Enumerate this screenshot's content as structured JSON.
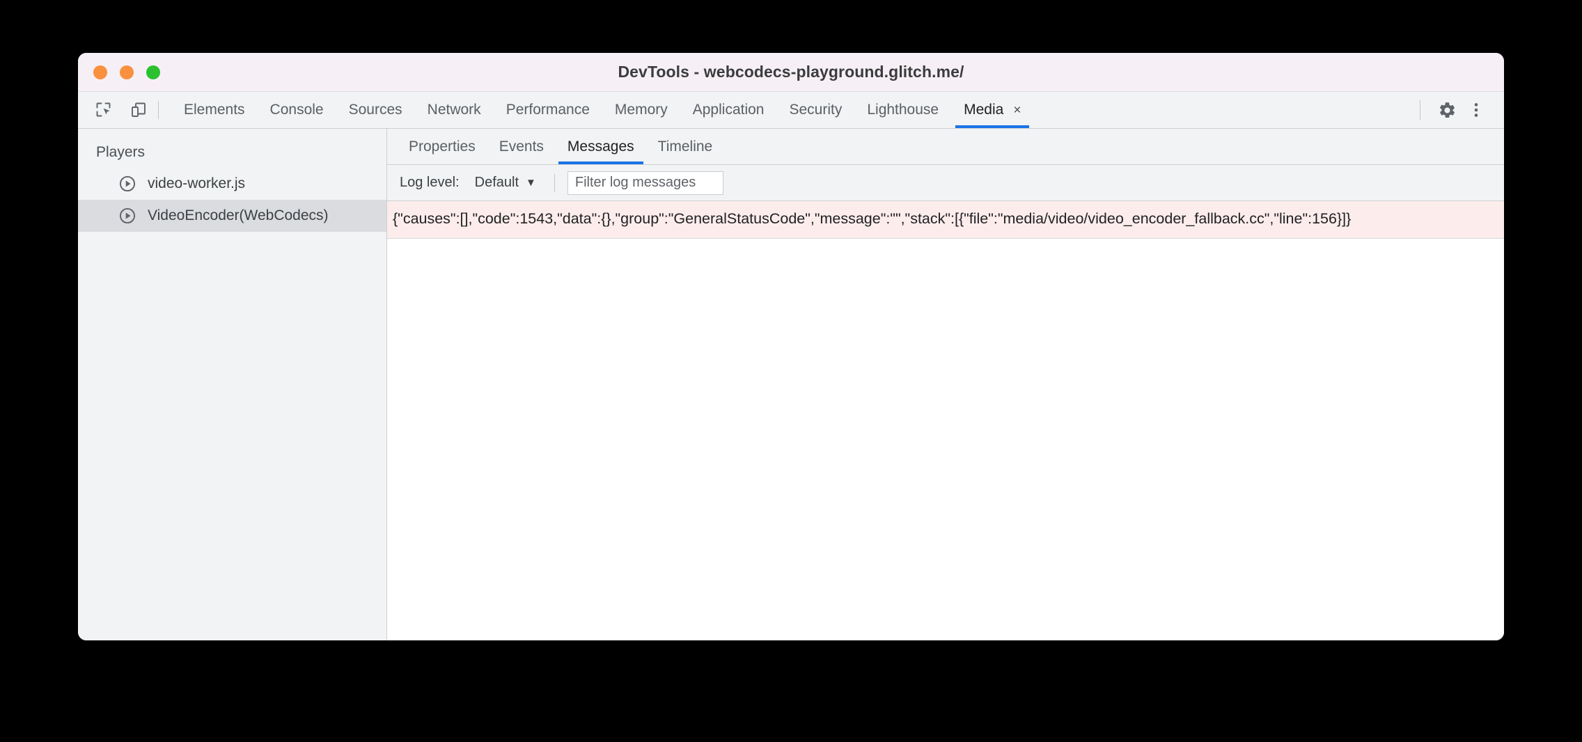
{
  "window": {
    "title": "DevTools - webcodecs-playground.glitch.me/",
    "traffic_lights": {
      "close_color": "#f9903e",
      "minimize_color": "#f9903e",
      "maximize_color": "#2bc030"
    }
  },
  "toolbar": {
    "inspect_icon": "inspect-element-icon",
    "device_icon": "device-toolbar-icon",
    "settings_icon": "gear-icon",
    "more_icon": "more-vertical-icon"
  },
  "tabs": [
    {
      "label": "Elements",
      "active": false,
      "closable": false
    },
    {
      "label": "Console",
      "active": false,
      "closable": false
    },
    {
      "label": "Sources",
      "active": false,
      "closable": false
    },
    {
      "label": "Network",
      "active": false,
      "closable": false
    },
    {
      "label": "Performance",
      "active": false,
      "closable": false
    },
    {
      "label": "Memory",
      "active": false,
      "closable": false
    },
    {
      "label": "Application",
      "active": false,
      "closable": false
    },
    {
      "label": "Security",
      "active": false,
      "closable": false
    },
    {
      "label": "Lighthouse",
      "active": false,
      "closable": false
    },
    {
      "label": "Media",
      "active": true,
      "closable": true,
      "close_label": "×"
    }
  ],
  "sidebar": {
    "title": "Players",
    "items": [
      {
        "label": "video-worker.js",
        "icon": "play-circle-icon",
        "selected": false
      },
      {
        "label": "VideoEncoder(WebCodecs)",
        "icon": "play-circle-icon",
        "selected": true
      }
    ]
  },
  "subtabs": [
    {
      "label": "Properties",
      "active": false
    },
    {
      "label": "Events",
      "active": false
    },
    {
      "label": "Messages",
      "active": true
    },
    {
      "label": "Timeline",
      "active": false
    }
  ],
  "logbar": {
    "log_level_label": "Log level:",
    "log_level_value": "Default",
    "caret": "▼",
    "filter_placeholder": "Filter log messages",
    "filter_value": ""
  },
  "messages": [
    {
      "level": "error",
      "text": "{\"causes\":[],\"code\":1543,\"data\":{},\"group\":\"GeneralStatusCode\",\"message\":\"\",\"stack\":[{\"file\":\"media/video/video_encoder_fallback.cc\",\"line\":156}]}",
      "background_color": "#fdecec"
    }
  ],
  "colors": {
    "accent": "#1a73e8",
    "chrome_bg": "#f1f3f4",
    "titlebar_bg": "#f6f0f6",
    "selected_row": "#dadce0",
    "error_bg": "#fdecec"
  }
}
